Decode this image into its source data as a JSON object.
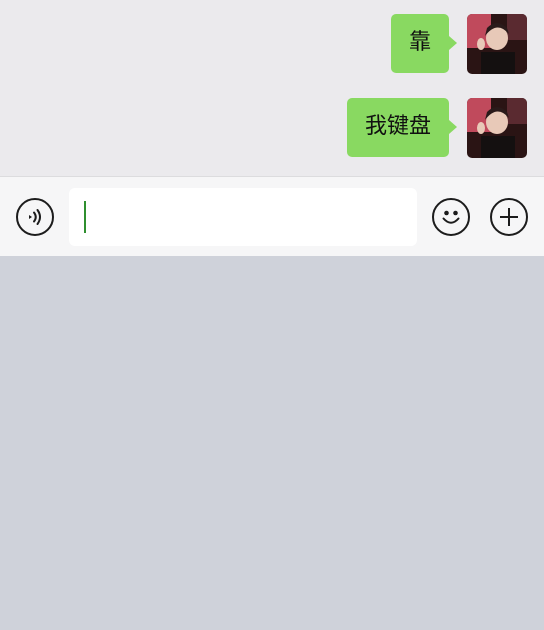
{
  "chat": {
    "messages": [
      {
        "text": "靠",
        "from": "me"
      },
      {
        "text": "我键盘",
        "from": "me"
      }
    ]
  },
  "input": {
    "value": "",
    "icons": {
      "voice": "voice-icon",
      "emoji": "emoji-icon",
      "more": "plus-icon"
    }
  },
  "colors": {
    "bubble": "#89d961",
    "chat_bg": "#ebeaed",
    "input_bar_bg": "#f6f6f7",
    "keyboard_bg": "#cfd2da",
    "caret": "#2f8f2f"
  }
}
